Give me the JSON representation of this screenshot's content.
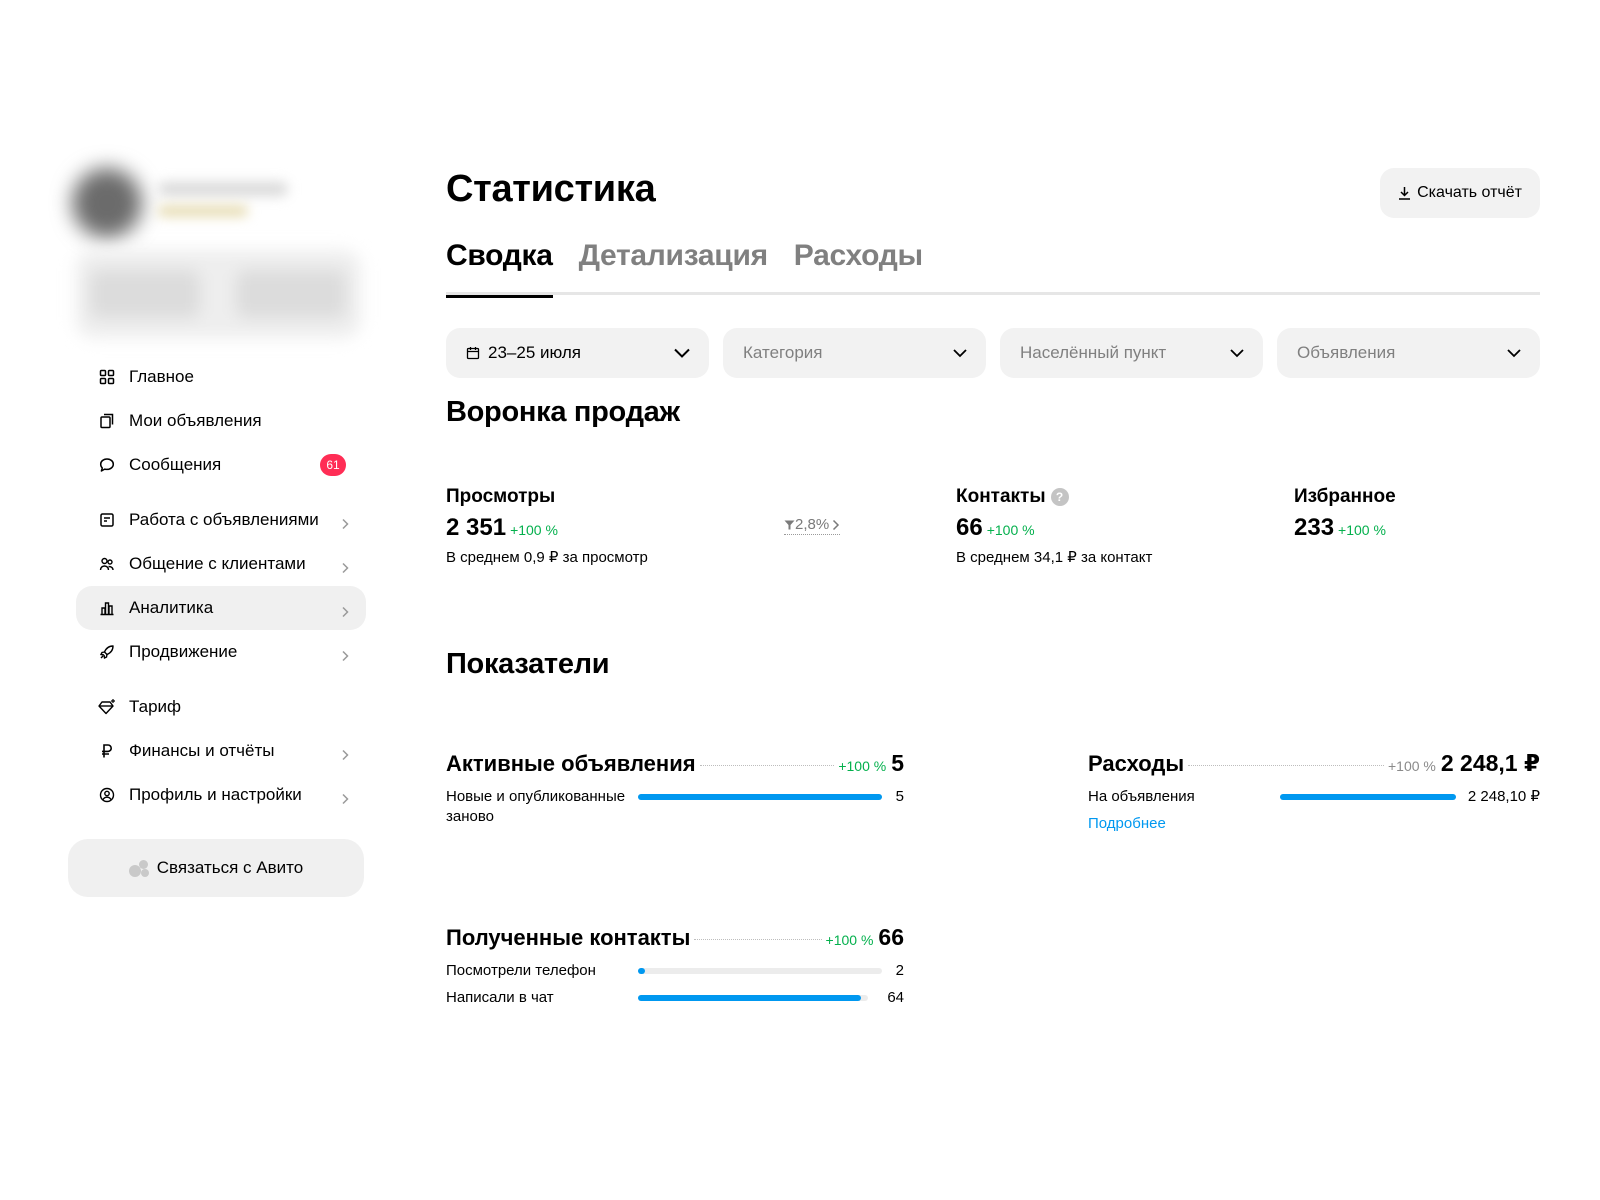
{
  "sidebar": {
    "nav_groups": [
      [
        {
          "label": "Главное",
          "icon": "grid-icon",
          "chevron": false
        },
        {
          "label": "Мои объявления",
          "icon": "listings-icon",
          "chevron": false
        },
        {
          "label": "Сообщения",
          "icon": "chat-icon",
          "chevron": false,
          "badge": "61"
        }
      ],
      [
        {
          "label": "Работа с объявлениями",
          "icon": "clipboard-icon",
          "chevron": true
        },
        {
          "label": "Общение с клиентами",
          "icon": "people-icon",
          "chevron": true
        },
        {
          "label": "Аналитика",
          "icon": "analytics-icon",
          "chevron": true,
          "active": true
        },
        {
          "label": "Продвижение",
          "icon": "rocket-icon",
          "chevron": true
        }
      ],
      [
        {
          "label": "Тариф",
          "icon": "diamond-icon",
          "chevron": false
        },
        {
          "label": "Финансы и отчёты",
          "icon": "ruble-icon",
          "chevron": true
        },
        {
          "label": "Профиль и настройки",
          "icon": "profile-icon",
          "chevron": true
        }
      ]
    ],
    "contact_button": "Связаться с Авито"
  },
  "header": {
    "title": "Статистика",
    "download_label": "Скачать отчёт"
  },
  "tabs": [
    {
      "label": "Сводка",
      "active": true
    },
    {
      "label": "Детализация",
      "active": false
    },
    {
      "label": "Расходы",
      "active": false
    }
  ],
  "filters": {
    "date": "23–25 июля",
    "category": "Категория",
    "location": "Населённый пункт",
    "ads": "Объявления"
  },
  "funnel": {
    "title": "Воронка продаж",
    "views": {
      "label": "Просмотры",
      "value": "2 351",
      "delta": "+100 %",
      "note": "В среднем 0,9 ₽ за просмотр"
    },
    "conversion": "2,8%",
    "contacts": {
      "label": "Контакты",
      "value": "66",
      "delta": "+100 %",
      "note": "В среднем 34,1 ₽ за контакт"
    },
    "favorites": {
      "label": "Избранное",
      "value": "233",
      "delta": "+100 %"
    }
  },
  "indicators": {
    "title": "Показатели",
    "active_ads": {
      "title": "Активные объявления",
      "delta": "+100 %",
      "value": "5",
      "rows": [
        {
          "label": "Новые и опубликованные заново",
          "value": "5",
          "fraction": 1.0
        }
      ]
    },
    "expenses": {
      "title": "Расходы",
      "delta": "+100 %",
      "value": "2 248,1 ₽",
      "rows": [
        {
          "label": "На объявления",
          "value": "2 248,10 ₽",
          "fraction": 1.0
        }
      ],
      "more": "Подробнее"
    },
    "contacts": {
      "title": "Полученные контакты",
      "delta": "+100 %",
      "value": "66",
      "rows": [
        {
          "label": "Посмотрели телефон",
          "value": "2",
          "fraction": 0.03
        },
        {
          "label": "Написали в чат",
          "value": "64",
          "fraction": 0.97
        }
      ]
    }
  },
  "colors": {
    "accent": "#0098f0",
    "positive": "#04b04d",
    "badge": "#ff2d55"
  }
}
